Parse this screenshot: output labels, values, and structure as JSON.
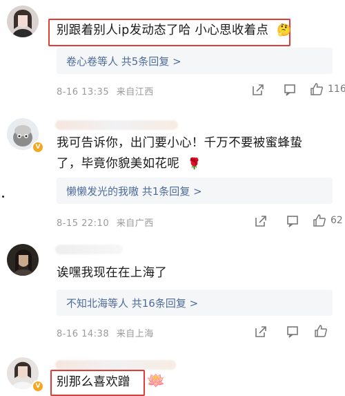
{
  "comments": [
    {
      "text": "别跟着别人ip发动态了哈 小心思收着点",
      "emoji": "🤔",
      "reply_summary": "卷心卷等人 共5条回复 >",
      "date": "8-16 13:35",
      "location": "来自江西",
      "likes": "116"
    },
    {
      "text_line1": "我可告诉你，出门要小心！千万不要被蜜蜂蛰",
      "text_line2": "了，毕竟你貌美如花呢",
      "emoji": "🌹",
      "reply_summary": "懒懒发光的我嗷 共1条回复 >",
      "date": "8-15 22:10",
      "location": "来自广西",
      "likes": "62"
    },
    {
      "text": "诶嘿我现在在上海了",
      "reply_summary": "不知北海等人 共16条回复 >",
      "date": "8-16 14:38",
      "location": "来自上海",
      "likes": ""
    },
    {
      "text": "别那么喜欢蹭",
      "emoji": "🪷"
    }
  ],
  "icons": [
    "share-icon",
    "comment-icon",
    "like-icon"
  ],
  "colors": {
    "highlight_box": "#e53935",
    "reply_link": "#4d6c9b",
    "meta_text": "#9a9a9a"
  }
}
